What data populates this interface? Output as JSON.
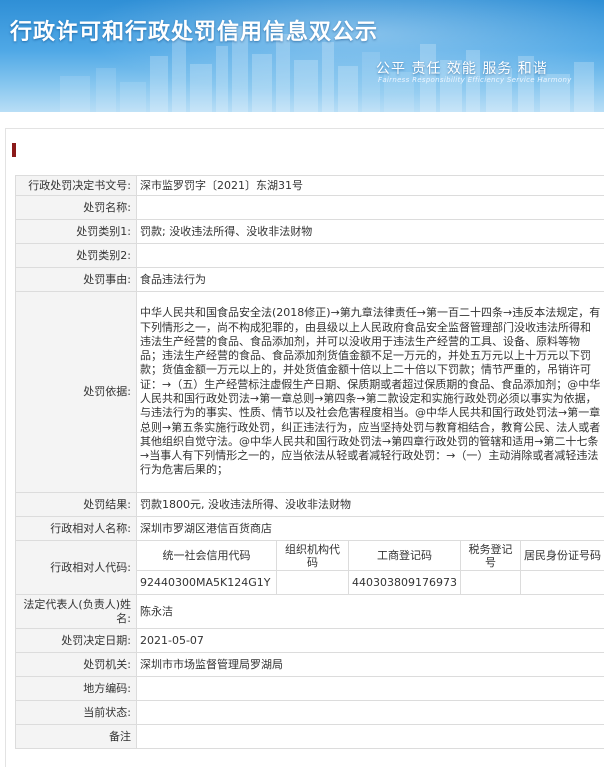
{
  "banner": {
    "title": "行政许可和行政处罚信用信息双公示",
    "slogan": "公平  责任  效能  服务  和谐",
    "slogan_en": "Fairness  Responsibility  Efficiency  Service  Harmony"
  },
  "colors": {
    "banner_top": "#2f8fd6",
    "banner_bottom": "#b9def6",
    "accent_mark": "#8b1a1a",
    "label_bg": "#f4f4f4",
    "border": "#dcdcdc"
  },
  "record": {
    "decision_no": {
      "label": "行政处罚决定书文号:",
      "value": "深市监罗罚字〔2021〕东湖31号"
    },
    "case_name": {
      "label": "处罚名称:",
      "value": ""
    },
    "category1": {
      "label": "处罚类别1:",
      "value": "罚款; 没收违法所得、没收非法财物"
    },
    "category2": {
      "label": "处罚类别2:",
      "value": ""
    },
    "reason": {
      "label": "处罚事由:",
      "value": "食品违法行为"
    },
    "basis": {
      "label": "处罚依据:",
      "value": "中华人民共和国食品安全法(2018修正)→第九章法律责任→第一百二十四条→违反本法规定，有下列情形之一，尚不构成犯罪的，由县级以上人民政府食品安全监督管理部门没收违法所得和违法生产经营的食品、食品添加剂，并可以没收用于违法生产经营的工具、设备、原料等物品；违法生产经营的食品、食品添加剂货值金额不足一万元的，并处五万元以上十万元以下罚款；货值金额一万元以上的，并处货值金额十倍以上二十倍以下罚款；情节严重的，吊销许可证：→（五）生产经营标注虚假生产日期、保质期或者超过保质期的食品、食品添加剂；@中华人民共和国行政处罚法→第一章总则→第四条→第二款设定和实施行政处罚必须以事实为依据，与违法行为的事实、性质、情节以及社会危害程度相当。@中华人民共和国行政处罚法→第一章总则→第五条实施行政处罚，纠正违法行为，应当坚持处罚与教育相结合，教育公民、法人或者其他组织自觉守法。@中华人民共和国行政处罚法→第四章行政处罚的管辖和适用→第二十七条→当事人有下列情形之一的，应当依法从轻或者减轻行政处罚：→（一）主动消除或者减轻违法行为危害后果的；"
    },
    "result": {
      "label": "处罚结果:",
      "value": "罚款1800元, 没收违法所得、没收非法财物"
    },
    "party_name": {
      "label": "行政相对人名称:",
      "value": "深圳市罗湖区港信百货商店"
    },
    "party_codes": {
      "label": "行政相对人代码:",
      "headers": [
        "统一社会信用代码",
        "组织机构代码",
        "工商登记码",
        "税务登记号",
        "居民身份证号码"
      ],
      "values": [
        "92440300MA5K124G1Y",
        "",
        "440303809176973",
        "",
        ""
      ]
    },
    "legal_rep": {
      "label": "法定代表人(负责人)姓名:",
      "value": "陈永洁"
    },
    "decision_date": {
      "label": "处罚决定日期:",
      "value": "2021-05-07"
    },
    "authority": {
      "label": "处罚机关:",
      "value": "深圳市市场监督管理局罗湖局"
    },
    "region_code": {
      "label": "地方编码:",
      "value": ""
    },
    "status": {
      "label": "当前状态:",
      "value": ""
    },
    "remarks": {
      "label": "备注",
      "value": ""
    }
  }
}
